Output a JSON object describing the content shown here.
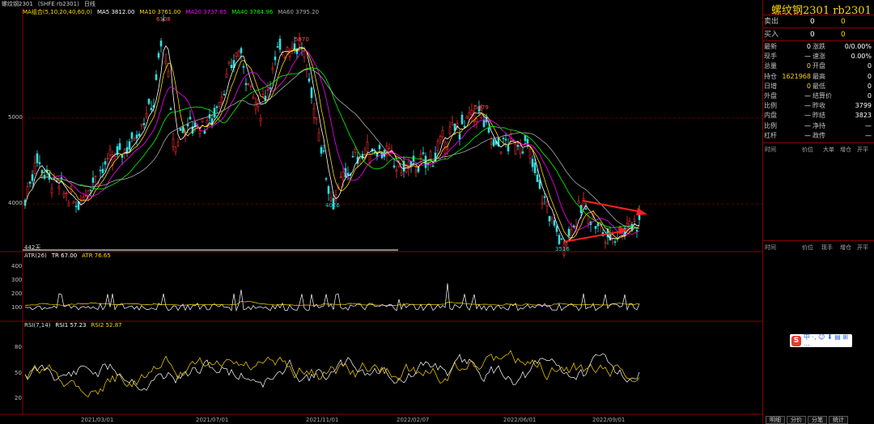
{
  "topbar": {
    "name": "螺纹钢2301",
    "code": "(SHFE rb2301)",
    "period": "日线"
  },
  "ma": {
    "label": "MA组合(5,10,20,40,60,0)",
    "ma5": "MA5 3812.00",
    "ma10": "MA10 3761.00",
    "ma20": "MA20 3737.85",
    "ma40": "MA40 3784.96",
    "ma60": "MA60 3795.20",
    "colors": {
      "ma5": "#ffffff",
      "ma10": "#ffd700",
      "ma20": "#ff00ff",
      "ma40": "#00ff00",
      "ma60": "#aaaaaa"
    }
  },
  "price_axis": [
    "5000",
    "4000"
  ],
  "annotations": {
    "peak1": "6108",
    "peak2": "5870",
    "low1": "4026",
    "peak3": "5079",
    "low2": "3516",
    "days": "442天"
  },
  "atr": {
    "label": "ATR(26)",
    "tr": "TR 67.00",
    "atr": "ATR 76.65",
    "ticks": [
      "400",
      "300",
      "200",
      "100"
    ]
  },
  "rsi": {
    "label": "RSI(7,14)",
    "rsi1": "RSI1 57.23",
    "rsi2": "RSI2 52.87",
    "ticks": [
      "80",
      "50",
      "20"
    ]
  },
  "dates": [
    "2021/03/01",
    "2021/07/01",
    "2021/11/01",
    "2022/02/07",
    "2022/06/01",
    "2022/09/01"
  ],
  "side": {
    "title": "螺纹钢2301  rb2301",
    "ask_label": "卖出",
    "ask_price": "0",
    "ask_vol": "0",
    "bid_label": "买入",
    "bid_price": "0",
    "bid_vol": "0",
    "rows": [
      {
        "l1": "最新",
        "v1": "0",
        "l2": "涨跌",
        "v2": "0/0.00%"
      },
      {
        "l1": "现手",
        "v1": "—",
        "l2": "速涨",
        "v2": "0.00%"
      },
      {
        "l1": "总量",
        "v1": "0",
        "l2": "开盘",
        "v2": "0"
      },
      {
        "l1": "持仓",
        "v1": "1621968",
        "l2": "最高",
        "v2": "0"
      },
      {
        "l1": "日增",
        "v1": "0",
        "l2": "最低",
        "v2": "0"
      },
      {
        "l1": "外盘",
        "v1": "—",
        "l2": "结算价",
        "v2": "0"
      },
      {
        "l1": "比例",
        "v1": "—",
        "l2": "昨收",
        "v2": "3799"
      },
      {
        "l1": "内盘",
        "v1": "—",
        "l2": "昨结",
        "v2": "3823"
      },
      {
        "l1": "比例",
        "v1": "—",
        "l2": "净持",
        "v2": "—"
      },
      {
        "l1": "杠杆",
        "v1": "—",
        "l2": "政传",
        "v2": "—"
      }
    ],
    "trade_headers": [
      "时间",
      "价位",
      "大单",
      "增仓",
      "开平"
    ],
    "tick_headers": [
      "时间",
      "价位",
      "现手",
      "增仓",
      "开平"
    ]
  },
  "tabs": [
    "明细",
    "分价",
    "分笔",
    "统计"
  ],
  "ime": {
    "s": "S",
    "items": "中 ·, ☺ ⬇ ▤ ⊞ ⋯"
  }
}
